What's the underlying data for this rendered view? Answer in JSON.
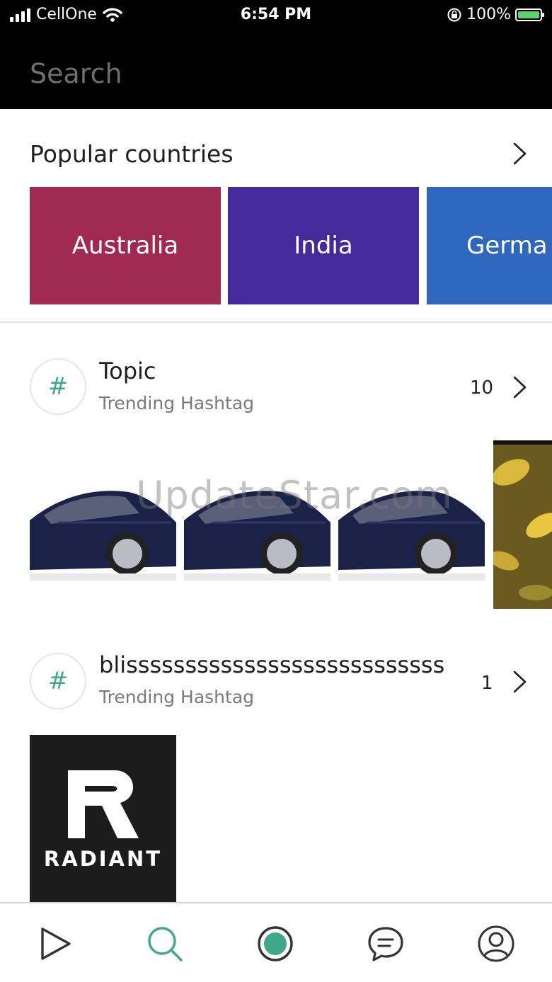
{
  "status_bar": {
    "carrier": "CellOne",
    "time": "6:54 PM",
    "battery": "100%",
    "icons": [
      "signal-icon",
      "wifi-icon",
      "orientation-lock-icon",
      "battery-charging-icon"
    ]
  },
  "search": {
    "placeholder": "Search",
    "scan_icon": "scan-icon"
  },
  "popular_countries": {
    "title": "Popular countries",
    "countries": [
      {
        "name": "Australia",
        "color": "#a12a52"
      },
      {
        "name": "India",
        "color": "#432b9c"
      },
      {
        "name": "Germa",
        "color": "#2f67bf"
      }
    ]
  },
  "hashtags": [
    {
      "name": "Topic",
      "subtitle": "Trending Hashtag",
      "count": "10",
      "thumbnails": [
        "car-thumbnail",
        "car-thumbnail",
        "car-thumbnail",
        "leaves-thumbnail"
      ]
    },
    {
      "name": "blisssssssssssssssssssssssssss",
      "subtitle": "Trending Hashtag",
      "count": "1",
      "thumbnails": [
        "radiant-logo-thumbnail"
      ]
    }
  ],
  "radiant_logo_text": "RADIANT",
  "watermark": "UpdateStar.com",
  "tab_bar": {
    "items": [
      {
        "icon": "play-icon",
        "active": false
      },
      {
        "icon": "search-icon",
        "active": true
      },
      {
        "icon": "record-icon",
        "active": false
      },
      {
        "icon": "chat-icon",
        "active": false
      },
      {
        "icon": "profile-icon",
        "active": false
      }
    ],
    "accent_color": "#3ea88a"
  }
}
